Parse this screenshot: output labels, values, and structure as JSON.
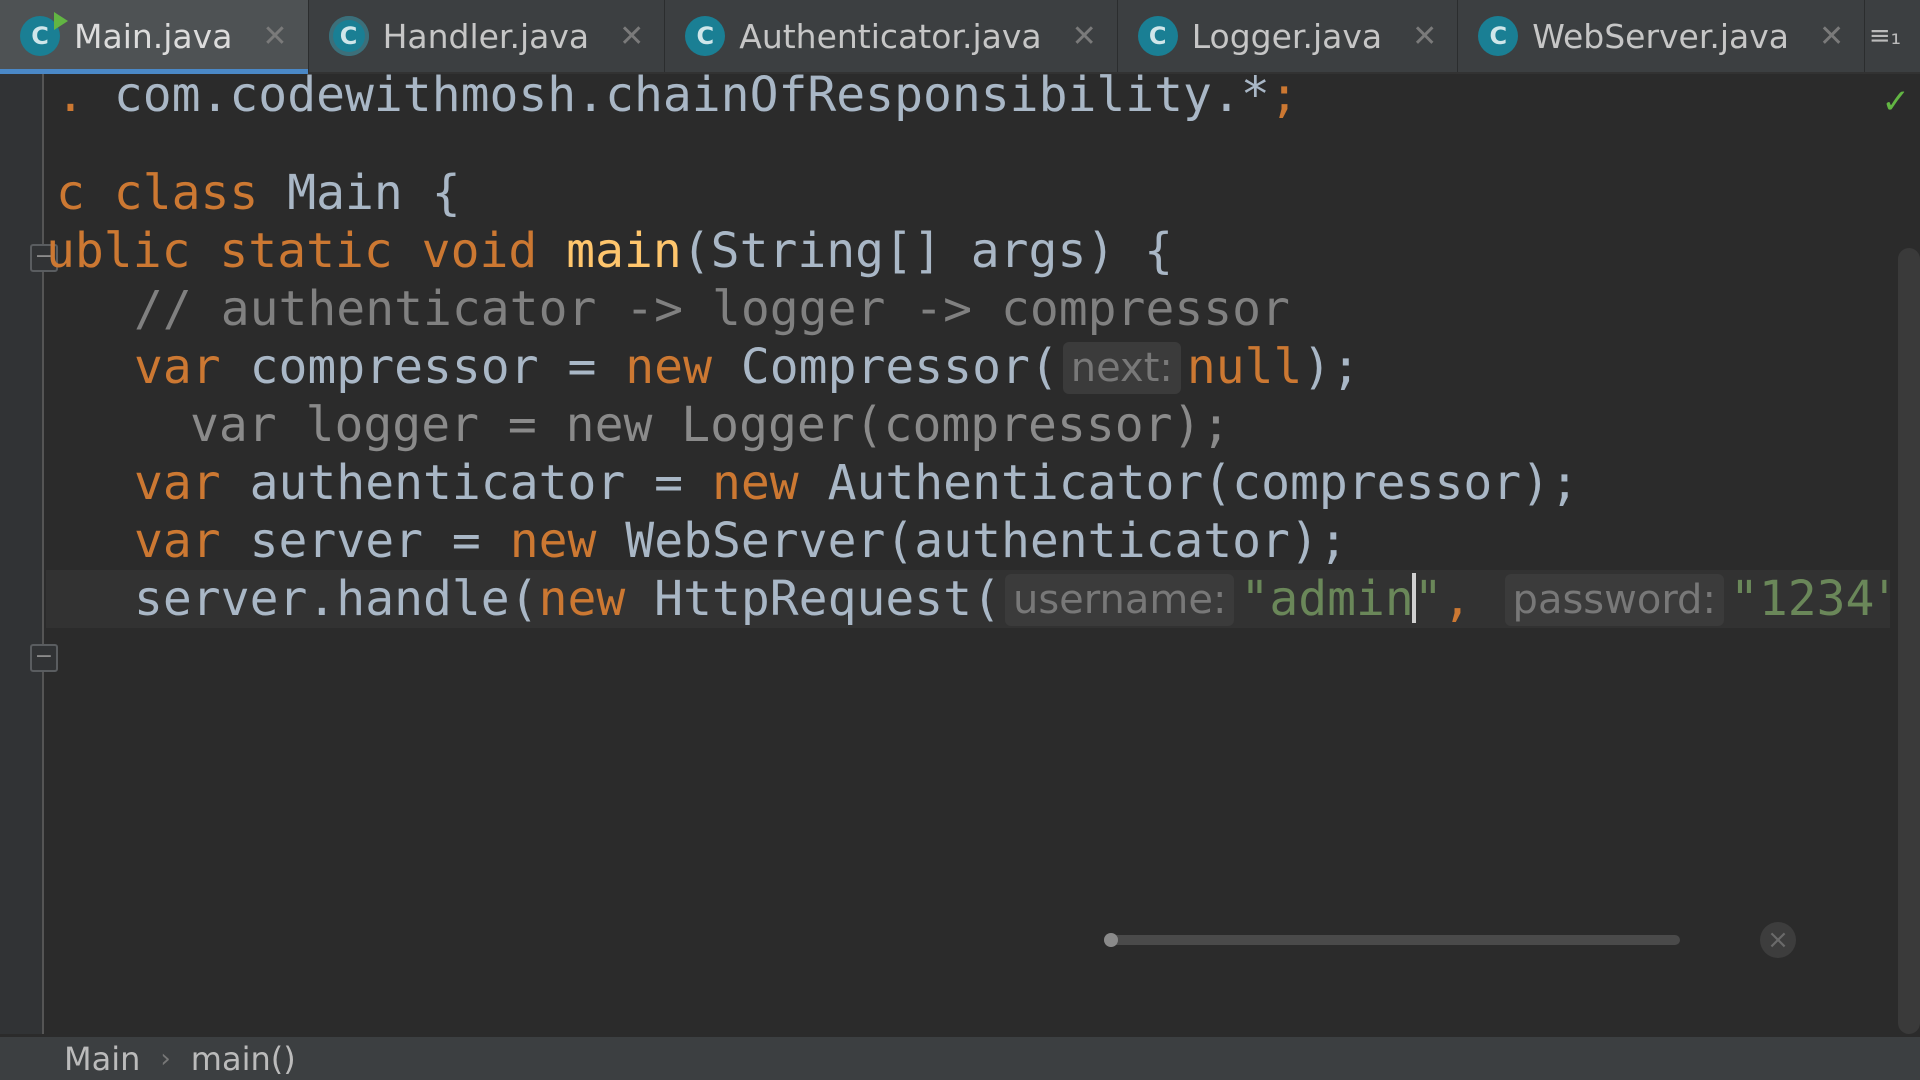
{
  "tabs": [
    {
      "label": "Main.java",
      "icon": "class-icon",
      "active": true
    },
    {
      "label": "Handler.java",
      "icon": "abstract-class-icon",
      "active": false
    },
    {
      "label": "Authenticator.java",
      "icon": "class-icon",
      "active": false
    },
    {
      "label": "Logger.java",
      "icon": "class-icon",
      "active": false
    },
    {
      "label": "WebServer.java",
      "icon": "class-icon",
      "active": false
    }
  ],
  "tab_close_glyph": "✕",
  "tab_icon_letter": "C",
  "tabs_menu_label": "≡₁",
  "code": {
    "import_line": {
      "partial": ".",
      "pkg": "com.codewithmosh.chainOfResponsibility.*",
      "semi": ";"
    },
    "class_line": {
      "kw": "c class",
      "name": " Main {"
    },
    "main_line": {
      "mods": "ublic static void ",
      "fn": "main",
      "rest": "(String[] args) {"
    },
    "comment": "// authenticator -> logger -> compressor",
    "compressor_line": {
      "kw1": "var",
      "mid": " compressor = ",
      "kw2": "new",
      "ctor": " Compressor(",
      "hint": "next:",
      "val": "null",
      "end": ");"
    },
    "logger_line": "var logger = new Logger(compressor);",
    "auth_line": {
      "kw1": "var",
      "mid": " authenticator = ",
      "kw2": "new",
      "rest": " Authenticator(compressor);"
    },
    "server_line": {
      "kw1": "var",
      "mid": " server = ",
      "kw2": "new",
      "rest": " WebServer(authenticator);"
    },
    "handle_line": {
      "pre": "server.handle(",
      "kw": "new",
      "ctor": " HttpRequest(",
      "hint1": "username:",
      "str1a": "\"admin",
      "str1b": "\"",
      "comma": ",",
      "hint2": "password:",
      "str2": "\"1234\"",
      "end": ")"
    }
  },
  "inspection_ok": "✓",
  "breadcrumbs": [
    "Main",
    "main()"
  ],
  "breadcrumb_sep": "›",
  "colors": {
    "keyword": "#cc7832",
    "function": "#ffc66d",
    "string": "#6a8759",
    "comment": "#808080",
    "accent": "#4a88c7"
  }
}
